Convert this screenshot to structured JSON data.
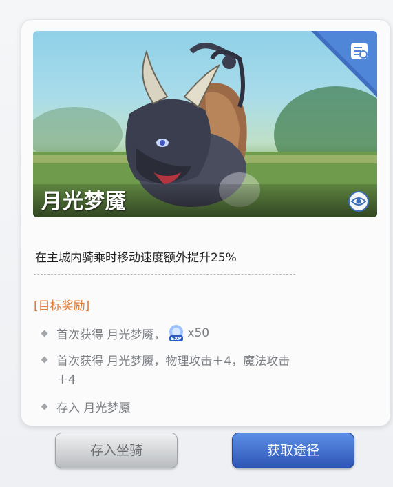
{
  "mount": {
    "name": "月光梦魇",
    "description": "在主城内骑乘时移动速度额外提升25%"
  },
  "rewards": {
    "title": "[目标奖励]",
    "items": [
      {
        "text": "首次获得 月光梦魇，",
        "suffix": "x50",
        "icon": "exp-icon"
      },
      {
        "text": "首次获得 月光梦魇，物理攻击＋4，魔法攻击",
        "text2": "＋4"
      },
      {
        "text": "存入 月光梦魇"
      }
    ]
  },
  "buttons": {
    "store_label": "存入坐骑",
    "source_label": "获取途径"
  },
  "icons": {
    "corner": "search-list-icon",
    "view": "eye-icon",
    "exp": "exp-icon"
  },
  "exp_badge": "EXP",
  "colors": {
    "accent_orange": "#e07a35",
    "primary_blue": "#2e55b6",
    "text_gray": "#7c8085"
  }
}
